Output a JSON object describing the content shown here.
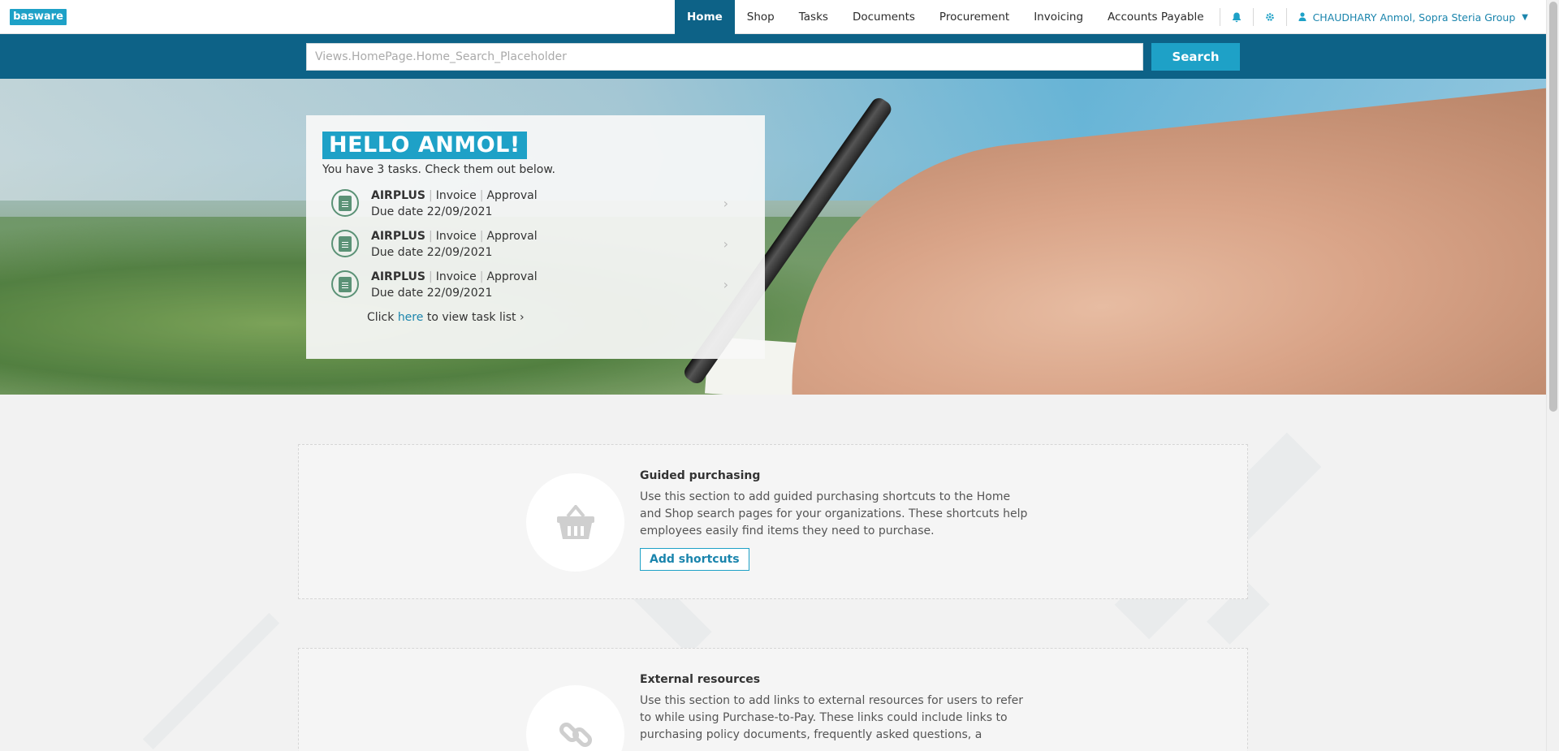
{
  "nav": {
    "logo": "basware",
    "items": [
      {
        "label": "Home",
        "active": true
      },
      {
        "label": "Shop"
      },
      {
        "label": "Tasks"
      },
      {
        "label": "Documents"
      },
      {
        "label": "Procurement"
      },
      {
        "label": "Invoicing"
      },
      {
        "label": "Accounts Payable"
      }
    ],
    "notifications_icon": "bell-icon",
    "settings_icon": "gear-icon",
    "user_label": "CHAUDHARY Anmol, Sopra Steria Group",
    "user_icon": "user-icon"
  },
  "search": {
    "placeholder": "Views.HomePage.Home_Search_Placeholder",
    "button_label": "Search"
  },
  "greeting": {
    "title": "HELLO ANMOL!",
    "subtitle": "You have 3 tasks. Check them out below.",
    "tasks": [
      {
        "supplier": "AIRPLUS",
        "type": "Invoice",
        "action": "Approval",
        "due": "Due date 22/09/2021"
      },
      {
        "supplier": "AIRPLUS",
        "type": "Invoice",
        "action": "Approval",
        "due": "Due date 22/09/2021"
      },
      {
        "supplier": "AIRPLUS",
        "type": "Invoice",
        "action": "Approval",
        "due": "Due date 22/09/2021"
      }
    ],
    "click_prefix": "Click ",
    "click_link": "here",
    "click_suffix": " to view task list ›"
  },
  "sections": {
    "guided": {
      "title": "Guided purchasing",
      "body": "Use this section to add guided purchasing shortcuts to the Home and Shop search pages for your organizations. These shortcuts help employees easily find items they need to purchase.",
      "button": "Add shortcuts",
      "icon": "basket-icon"
    },
    "external": {
      "title": "External resources",
      "body": "Use this section to add links to external resources for users to refer to while using Purchase-to-Pay. These links could include links to purchasing policy documents, frequently asked questions, a",
      "icon": "link-icon"
    }
  },
  "colors": {
    "brand": "#1ea1c7",
    "nav_active": "#0d6287",
    "task_icon": "#5b9276"
  }
}
